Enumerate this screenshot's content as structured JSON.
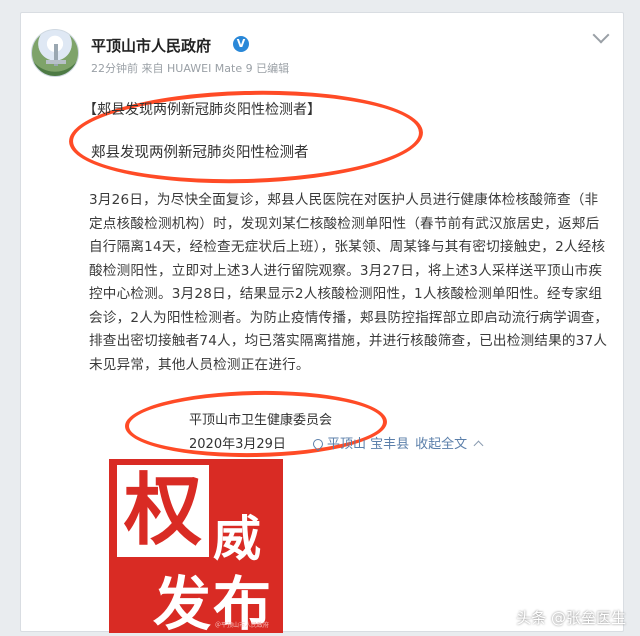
{
  "account": {
    "name": "平顶山市人民政府",
    "meta": "22分钟前  来自 HUAWEI Mate 9  已编辑"
  },
  "post": {
    "bracket_title": "【郏县发现两例新冠肺炎阳性检测者】",
    "headline": "郏县发现两例新冠肺炎阳性检测者",
    "body": "3月26日，为尽快全面复诊，郏县人民医院在对医护人员进行健康体检核酸筛查（非定点核酸检测机构）时，发现刘某仁核酸检测单阳性（春节前有武汉旅居史，返郏后自行隔离14天，经检查无症状后上班），张某领、周某锋与其有密切接触史，2人经核酸检测阳性，立即对上述3人进行留院观察。3月27日，将上述3人采样送平顶山市疾控中心检测。3月28日，结果显示2人核酸检测阳性，1人核酸检测单阳性。经专家组会诊，2人为阳性检测者。为防止疫情传播，郏县防控指挥部立即启动流行病学调查，排查出密切接触者74人，均已落实隔离措施，并进行核酸筛查，已出检测结果的37人未见异常，其他人员检测正在进行。",
    "signer": "平顶山市卫生健康委员会",
    "date": "2020年3月29日",
    "location": "平顶山 宝丰县",
    "collapse_label": "收起全文"
  },
  "promo": {
    "char1": "权",
    "char2": "威",
    "chars_bottom": "发布",
    "tiny_text": "＠平顶山市人民政府"
  },
  "watermark": "头条 @张垒医生",
  "colors": {
    "accent_red": "#d92b24",
    "annotation_red": "#ff4b26",
    "link_blue": "#5b7faa",
    "verify_blue": "#2a88d8"
  }
}
